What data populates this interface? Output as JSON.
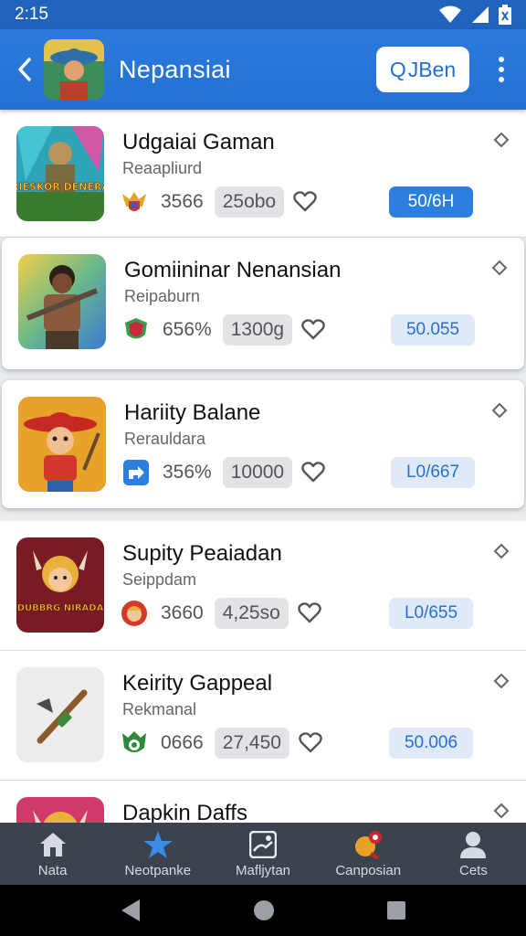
{
  "status_bar": {
    "time": "2:15"
  },
  "app_bar": {
    "title": "Nepansiai",
    "search_label": "JBen",
    "search_icon": "Q"
  },
  "items": [
    {
      "name": "Udgaiai Gaman",
      "subtitle": "Reaapliurd",
      "count": "3566",
      "chip": "25obo",
      "price": "50/6H",
      "price_active": true,
      "thumb_text": "RIESKOR DENERA",
      "badge_icon": "winged-shield-badge-icon"
    },
    {
      "name": "Gomiininar Nenansian",
      "subtitle": "Reipaburn",
      "count": "656%",
      "chip": "1300g",
      "price": "50.055",
      "price_active": false,
      "badge_icon": "shield-badge-icon"
    },
    {
      "name": "Hariity Balane",
      "subtitle": "Rerauldara",
      "count": "356%",
      "chip": "10000",
      "price": "L0/667",
      "price_active": false,
      "badge_icon": "arrow-badge-icon"
    },
    {
      "name": "Supity Peaiadan",
      "subtitle": "Seippdam",
      "count": "3660",
      "chip": "4,25so",
      "price": "L0/655",
      "price_active": false,
      "thumb_text": "DUBBRG NIRADA",
      "badge_icon": "face-badge-icon"
    },
    {
      "name": "Keirity Gappeal",
      "subtitle": "Rekmanal",
      "count": "0666",
      "chip": "27,450",
      "price": "50.006",
      "price_active": false,
      "badge_icon": "leaf-badge-icon"
    },
    {
      "name": "Dapkin Daffs"
    }
  ],
  "bottom_nav": [
    {
      "label": "Nata",
      "icon": "home-icon"
    },
    {
      "label": "Neotpanke",
      "icon": "star-icon"
    },
    {
      "label": "Mafljytan",
      "icon": "image-icon"
    },
    {
      "label": "Canposian",
      "icon": "ping-pong-icon"
    },
    {
      "label": "Cets",
      "icon": "person-icon"
    }
  ],
  "colors": {
    "app_bar": "#2470d3",
    "accent": "#2c7fe0",
    "bottom_nav": "#3b444e"
  }
}
